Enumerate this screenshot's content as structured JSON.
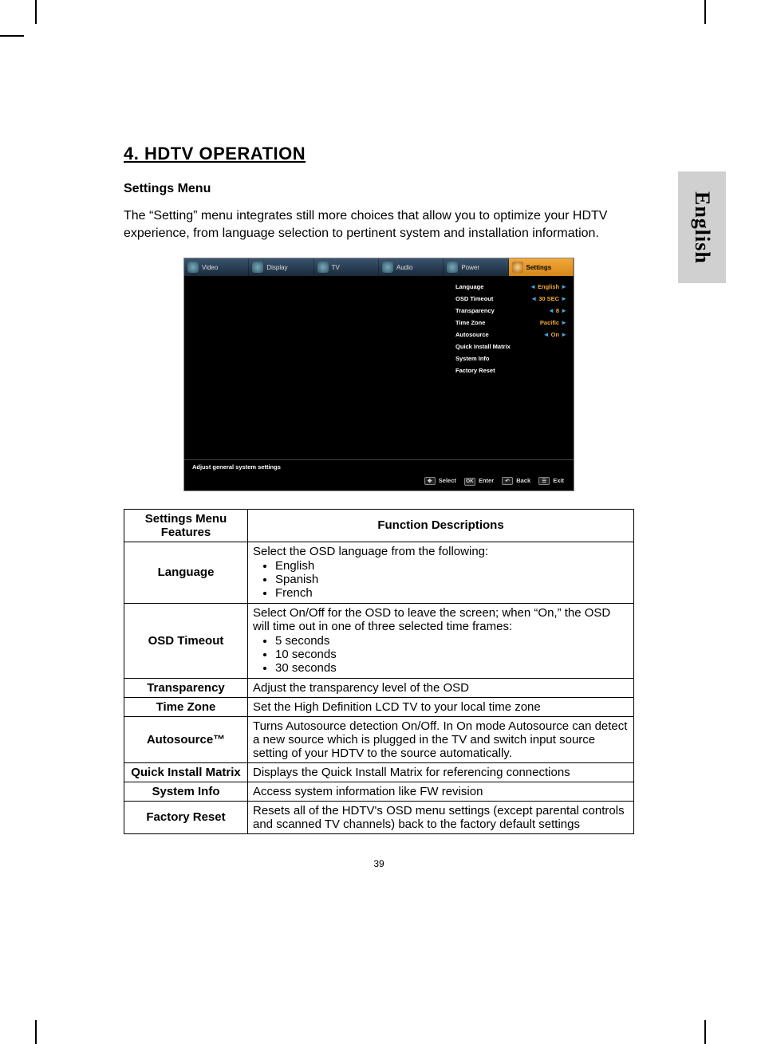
{
  "sideTab": "English",
  "heading": "4.    HDTV OPERATION",
  "subheading": "Settings Menu",
  "intro": "The “Setting” menu integrates still more choices that allow you to optimize your HDTV experience, from language selection to pertinent system and installation information.",
  "osd": {
    "tabs": [
      "Video",
      "Display",
      "TV",
      "Audio",
      "Power",
      "Settings"
    ],
    "activeTab": 5,
    "rows": [
      {
        "label": "Language",
        "value": "English",
        "arrows": true
      },
      {
        "label": "OSD Timeout",
        "value": "30 SEC",
        "arrows": true
      },
      {
        "label": "Transparency",
        "value": "8",
        "arrows": true
      },
      {
        "label": "Time Zone",
        "value": "Pacific",
        "arrows": "right"
      },
      {
        "label": "Autosource",
        "value": "On",
        "arrows": true
      },
      {
        "label": "Quick Install Matrix",
        "value": "",
        "arrows": false
      },
      {
        "label": "System Info",
        "value": "",
        "arrows": false
      },
      {
        "label": "Factory Reset",
        "value": "",
        "arrows": false
      }
    ],
    "hint": "Adjust general system settings",
    "footerKeys": [
      {
        "icon": "✥",
        "label": "Select"
      },
      {
        "icon": "OK",
        "label": "Enter"
      },
      {
        "icon": "↶",
        "label": "Back"
      },
      {
        "icon": "☰",
        "label": "Exit"
      }
    ]
  },
  "tableHead": {
    "c1": "Settings Menu Features",
    "c2": "Function Descriptions"
  },
  "tableRows": [
    {
      "feature": "Language",
      "desc": "Select the OSD language from the following:",
      "bullets": [
        "English",
        "Spanish",
        "French"
      ]
    },
    {
      "feature": "OSD Timeout",
      "desc": "Select On/Off for the OSD to leave the screen; when “On,” the OSD will time out in one of three selected time frames:",
      "bullets": [
        "5 seconds",
        "10 seconds",
        "30 seconds"
      ]
    },
    {
      "feature": "Transparency",
      "desc": "Adjust the transparency level of the OSD"
    },
    {
      "feature": "Time Zone",
      "desc": "Set the High Definition LCD TV to your local time zone"
    },
    {
      "feature": "Autosource™",
      "desc": "Turns Autosource detection On/Off.   In On mode Autosource can detect a new source which is plugged in the  TV and switch input source setting of your HDTV to the source automatically."
    },
    {
      "feature": "Quick Install Matrix",
      "desc": "Displays the Quick Install Matrix for referencing connections"
    },
    {
      "feature": "System Info",
      "desc": "Access system information like FW revision"
    },
    {
      "feature": "Factory Reset",
      "desc": "Resets all of the HDTV's OSD menu settings (except parental controls and scanned TV channels) back to the factory default settings"
    }
  ],
  "pageNum": "39"
}
